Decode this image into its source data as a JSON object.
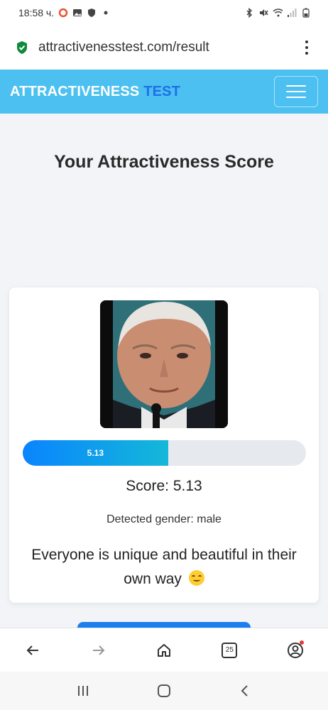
{
  "status_bar": {
    "time": "18:58 ч."
  },
  "browser": {
    "url": "attractivenesstest.com/result",
    "tab_count": "25"
  },
  "site": {
    "brand_part1": "ATTRACTIVENESS",
    "brand_part2": "TEST"
  },
  "page": {
    "title": "Your Attractiveness Score"
  },
  "result": {
    "score_value": 5.13,
    "score_label": "5.13",
    "score_max": 10,
    "score_fraction": 0.513,
    "score_text": "Score: 5.13",
    "gender_text": "Detected gender: male",
    "message": "Everyone is unique and beautiful in their own way"
  },
  "colors": {
    "header_bg": "#4cc0f0",
    "brand_accent": "#1f6fe8",
    "progress_start": "#0a84ff",
    "progress_end": "#14b8d8",
    "button_blue": "#1c7ef0"
  },
  "icons": {
    "status": [
      "circle-icon",
      "image-icon",
      "shield-icon",
      "bluetooth-icon",
      "mute-icon",
      "wifi-icon",
      "signal-icon",
      "battery-icon"
    ],
    "nav": [
      "back-arrow-icon",
      "forward-arrow-icon",
      "home-icon",
      "tabs-icon",
      "profile-icon"
    ],
    "system": [
      "recents-icon",
      "home-circle-icon",
      "back-chevron-icon"
    ]
  }
}
